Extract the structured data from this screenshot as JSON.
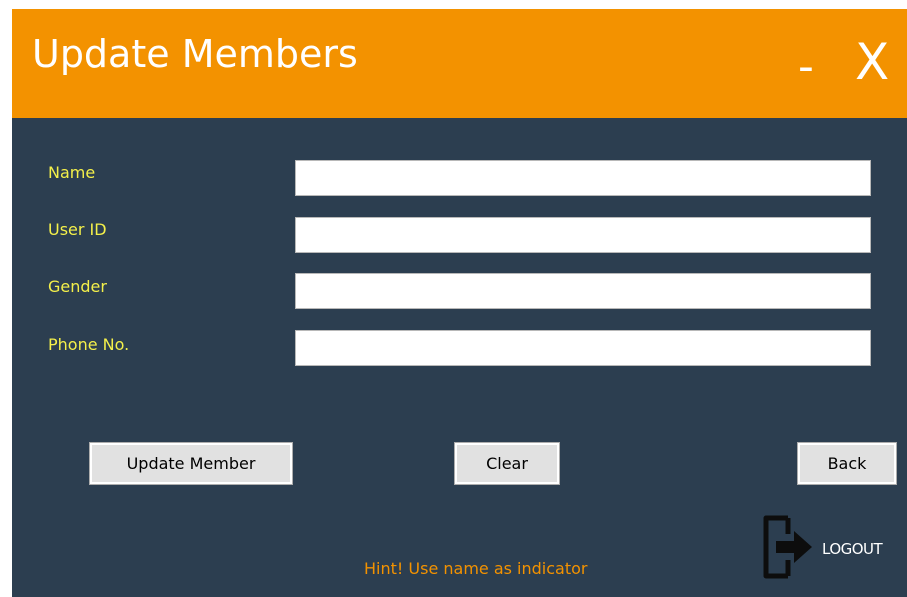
{
  "window": {
    "title": "Update Members",
    "minimize_label": "-",
    "close_label": "X"
  },
  "form": {
    "fields": [
      {
        "label": "Name",
        "value": ""
      },
      {
        "label": "User ID",
        "value": ""
      },
      {
        "label": "Gender",
        "value": ""
      },
      {
        "label": "Phone No.",
        "value": ""
      }
    ]
  },
  "buttons": {
    "update_label": "Update Member",
    "clear_label": "Clear",
    "back_label": "Back"
  },
  "hint": "Hint! Use name as indicator",
  "logout": {
    "label": "LOGOUT",
    "icon": "logout-icon"
  },
  "colors": {
    "titlebar": "#f39200",
    "background": "#2c3e50",
    "label_text": "#f4f04a",
    "hint_text": "#f39200"
  }
}
